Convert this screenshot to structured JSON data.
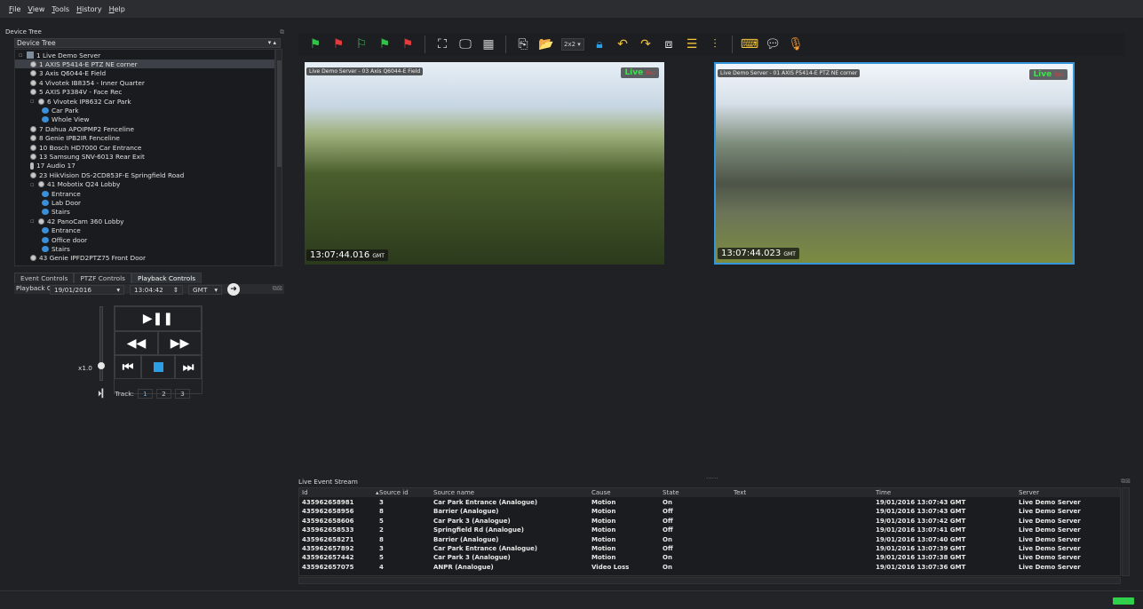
{
  "menu": [
    "File",
    "View",
    "Tools",
    "History",
    "Help"
  ],
  "device_tree": {
    "title": "Device Tree",
    "selector": "Device Tree",
    "items": [
      {
        "label": "1 Live Demo Server",
        "type": "server",
        "depth": 0
      },
      {
        "label": "1 AXIS P5414-E PTZ NE corner",
        "type": "camera",
        "depth": 1,
        "selected": true
      },
      {
        "label": "3 Axis Q6044-E Field",
        "type": "camera",
        "depth": 1
      },
      {
        "label": "4 Vivotek IB8354 - Inner Quarter",
        "type": "camera",
        "depth": 1
      },
      {
        "label": "5 AXIS P3384V - Face Rec",
        "type": "camera",
        "depth": 1
      },
      {
        "label": "6 Vivotek IP8632 Car Park",
        "type": "camera",
        "depth": 1
      },
      {
        "label": "Car Park",
        "type": "view",
        "depth": 2
      },
      {
        "label": "Whole View",
        "type": "view",
        "depth": 2
      },
      {
        "label": "7 Dahua APOIPMP2 Fenceline",
        "type": "camera",
        "depth": 1
      },
      {
        "label": "8 Genie IPB2IR Fenceline",
        "type": "camera",
        "depth": 1
      },
      {
        "label": "10 Bosch HD7000 Car Entrance",
        "type": "camera",
        "depth": 1
      },
      {
        "label": "13 Samsung SNV-6013 Rear Exit",
        "type": "camera",
        "depth": 1
      },
      {
        "label": "17 Audio 17",
        "type": "mic",
        "depth": 1
      },
      {
        "label": "23 HikVision DS-2CD853F-E Springfield Road",
        "type": "camera",
        "depth": 1
      },
      {
        "label": "41 Mobotix Q24 Lobby",
        "type": "camera",
        "depth": 1
      },
      {
        "label": "Entrance",
        "type": "view",
        "depth": 2
      },
      {
        "label": "Lab Door",
        "type": "view",
        "depth": 2
      },
      {
        "label": "Stairs",
        "type": "view",
        "depth": 2
      },
      {
        "label": "42 PanoCam 360 Lobby",
        "type": "camera",
        "depth": 1
      },
      {
        "label": "Entrance",
        "type": "view",
        "depth": 2
      },
      {
        "label": "Office door",
        "type": "view",
        "depth": 2
      },
      {
        "label": "Stairs",
        "type": "view",
        "depth": 2
      },
      {
        "label": "43 Genie IPFD2PTZ75 Front Door",
        "type": "camera",
        "depth": 1
      }
    ]
  },
  "control_tabs": [
    "Event Controls",
    "PTZF Controls",
    "Playback Controls"
  ],
  "playback": {
    "title": "Playback Controls",
    "date": "19/01/2016",
    "time": "13:04:42",
    "tz": "GMT",
    "speed": "x1.0",
    "track_label": "Track:",
    "tracks": [
      "1",
      "2",
      "3"
    ]
  },
  "toolbar": {
    "layout_value": "2x2"
  },
  "videos": [
    {
      "label": "Live Demo Server - 03 Axis Q6044-E Field",
      "live": "Live",
      "rec": "Rec",
      "time": "13:07:44.016",
      "tz": "GMT"
    },
    {
      "label": "Live Demo Server - 01 AXIS P5414-E PTZ NE corner",
      "live": "Live",
      "rec": "Rec",
      "time": "13:07:44.023",
      "tz": "GMT"
    }
  ],
  "events": {
    "title": "Live Event Stream",
    "columns": [
      "Id",
      "Source id",
      "Source name",
      "Cause",
      "State",
      "Text",
      "Time",
      "Server"
    ],
    "rows": [
      [
        "435962658981",
        "3",
        "Car Park Entrance (Analogue)",
        "Motion",
        "On",
        "",
        "19/01/2016 13:07:43 GMT",
        "Live Demo Server"
      ],
      [
        "435962658956",
        "8",
        "Barrier (Analogue)",
        "Motion",
        "Off",
        "",
        "19/01/2016 13:07:43 GMT",
        "Live Demo Server"
      ],
      [
        "435962658606",
        "5",
        "Car Park 3 (Analogue)",
        "Motion",
        "Off",
        "",
        "19/01/2016 13:07:42 GMT",
        "Live Demo Server"
      ],
      [
        "435962658533",
        "2",
        "Springfield Rd (Analogue)",
        "Motion",
        "Off",
        "",
        "19/01/2016 13:07:41 GMT",
        "Live Demo Server"
      ],
      [
        "435962658271",
        "8",
        "Barrier (Analogue)",
        "Motion",
        "On",
        "",
        "19/01/2016 13:07:40 GMT",
        "Live Demo Server"
      ],
      [
        "435962657892",
        "3",
        "Car Park Entrance (Analogue)",
        "Motion",
        "Off",
        "",
        "19/01/2016 13:07:39 GMT",
        "Live Demo Server"
      ],
      [
        "435962657442",
        "5",
        "Car Park 3 (Analogue)",
        "Motion",
        "On",
        "",
        "19/01/2016 13:07:38 GMT",
        "Live Demo Server"
      ],
      [
        "435962657075",
        "4",
        "ANPR (Analogue)",
        "Video Loss",
        "On",
        "",
        "19/01/2016 13:07:36 GMT",
        "Live Demo Server"
      ]
    ]
  },
  "colors": {
    "accent": "#3596dc",
    "live": "#3ce34a",
    "rec": "#e23c3c",
    "status_ok": "#2fd14a"
  }
}
